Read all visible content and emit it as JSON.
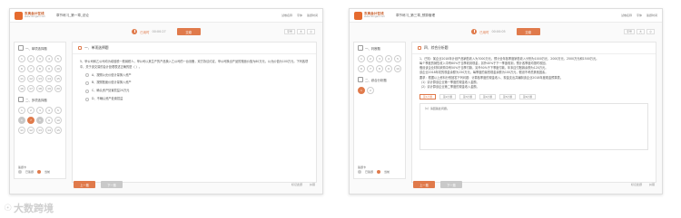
{
  "common": {
    "logo_name": "东奥会计在线",
    "logo_url": "www.dongao.com",
    "top_links": [
      "试卷名称",
      "字体",
      "答题时间"
    ],
    "timer_label": "已用时",
    "submit_label": "交卷",
    "font_ctrl": [
      "字号",
      "大",
      "小"
    ],
    "prev_label": "上一题",
    "next_label": "下一题",
    "footer_links": [
      "标记此题",
      "纠错"
    ],
    "legend": {
      "title": "答题卡",
      "answered": "已答题",
      "current": "当前",
      "marked": "标记题"
    }
  },
  "left": {
    "page_title": "章节练习_第一章_总论",
    "timer_value": "00:00:27",
    "section_title": "一、单项选择题",
    "section2_title": "二、多项选择题",
    "grid1": [
      "1",
      "2",
      "3",
      "4",
      "5",
      "6",
      "7",
      "8",
      "9",
      "10",
      "11",
      "12",
      "13",
      "14",
      "15",
      "16",
      "17",
      "18",
      "19",
      "20"
    ],
    "grid2": [
      "1",
      "2",
      "3",
      "4",
      "5",
      "6",
      "7",
      "8",
      "9",
      "10",
      "11",
      "12",
      "13",
      "14",
      "15"
    ],
    "q_type": "一、单项选择题",
    "q_text": "5、甲公司和乙公司均为增值税一般纳税人，甲公司以其生产的产品换入乙公司的一台设备，双方协议约定，甲公司换出产品的账面价值为80万元，公允价值为100万元，下列各项中，关于该交易的会计处理表述正确的是（   ）。",
    "options": [
      "A、按照公允价值计量换入资产",
      "B、按照账面价值计量换入资产",
      "C、确认资产处置损益20万元",
      "D、不确认资产处置损益"
    ]
  },
  "right": {
    "page_title": "章节练习_第三章_预算管理",
    "timer_value": "00:00:05",
    "section_title": "四、综合分析题",
    "section2_title": "一、判断题",
    "section3_title": "二、综合分析题",
    "grid1": [
      "1",
      "2",
      "3",
      "4",
      "5",
      "6",
      "7",
      "8",
      "9",
      "10"
    ],
    "grid2": [
      "1",
      "2"
    ],
    "q_type": "四、综合分析题",
    "q_lines": [
      "1、已知：某企业2018年计划产品销售收入为7000万元，预计全年各季度销售收入分别为1000万元、2000万元、2500万元和1500万元。",
      "每个季度的销售收入中有60%于当季收到现金，另外40%于下一季度收到，预计各季度均按时收回。",
      "假设该企业材料采购中有50%于当季付款，另外50%于下季度付款，年末应付账款余额为120万元。",
      "该企业2018年初的现金余额为150万元，每季度的最低现金余额为100万元，假设不考虑其他因素。",
      "要求：根据以上资料分别回答下列问题：计算各季度的现金收入、现金支出并编制该企业2018年度现金预算表。",
      "（1）请计算该企业第一季度的现金收入金额。",
      "（2）请计算该企业第二季度的现金收入金额。"
    ],
    "sub_tabs": [
      "第1小题",
      "第2小题",
      "第3小题",
      "第4小题",
      "第5小题",
      "第6小题"
    ],
    "answer_prompt": "（1）请回答此问题。"
  },
  "watermark": "大数跨境"
}
